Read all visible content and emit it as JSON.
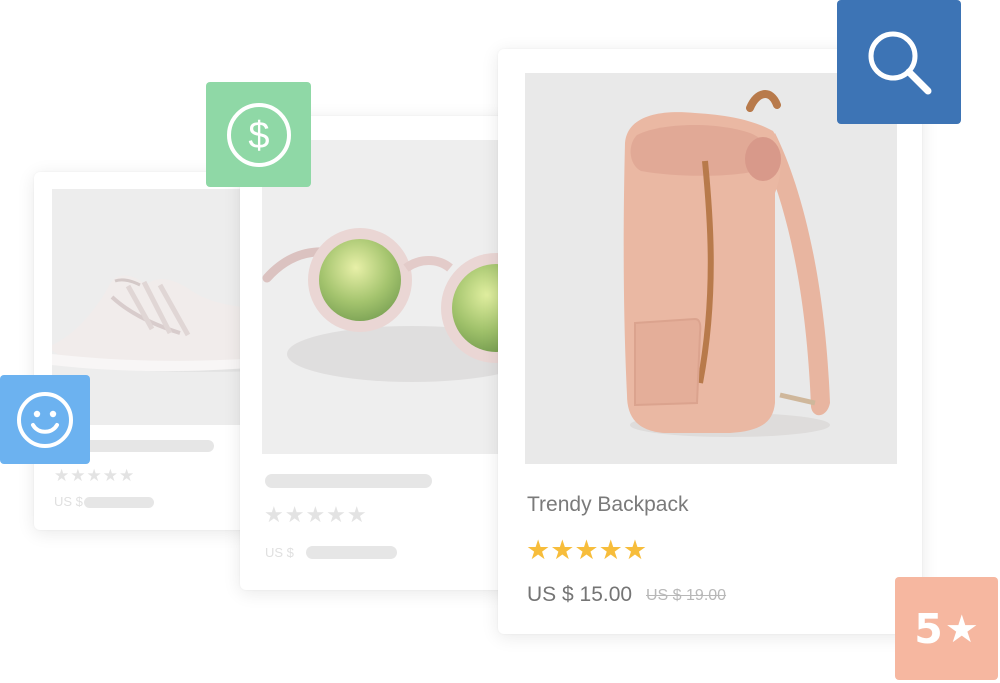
{
  "cards": [
    {
      "product": "sneaker",
      "stars": "★★★★★",
      "currency": "US $"
    },
    {
      "product": "sunglasses",
      "stars": "★★★★★",
      "currency": "US $"
    },
    {
      "product": "backpack",
      "title": "Trendy Backpack",
      "stars": "★★★★★",
      "rating": 5,
      "price": "US $ 15.00",
      "old_price": "US $ 19.00"
    }
  ],
  "badges": {
    "dollar_icon": "dollar-icon",
    "smiley_icon": "smiley-icon",
    "search_icon": "search-icon",
    "rating_value": "5",
    "rating_star": "★"
  },
  "colors": {
    "dollar_badge": "#8fd8a6",
    "smiley_badge": "#6cb2f0",
    "search_badge": "#3d74b5",
    "rating_badge": "#f6b7a0",
    "star": "#f7bd3b"
  }
}
